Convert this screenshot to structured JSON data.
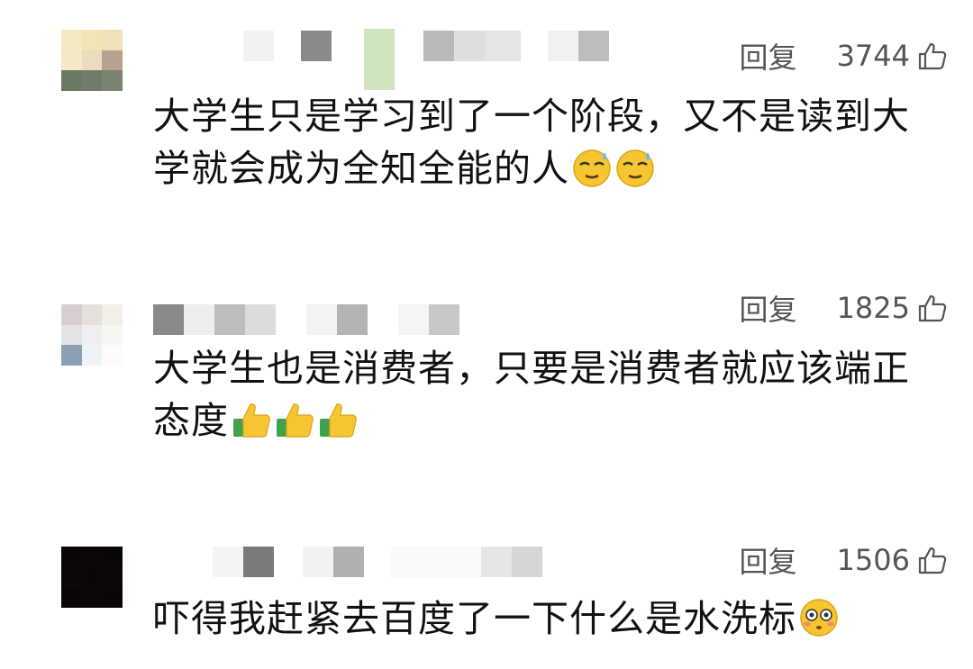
{
  "comments": [
    {
      "reply_label": "回复",
      "likes": "3744",
      "text": "大学生只是学习到了一个阶段，又不是读到大学就会成为全知全能的人",
      "emojis": [
        "sweat-smile-face-icon",
        "sweat-smile-face-icon"
      ]
    },
    {
      "reply_label": "回复",
      "likes": "1825",
      "text": "大学生也是消费者，只要是消费者就应该端正态度",
      "emojis": [
        "thumbs-up-icon",
        "thumbs-up-icon",
        "thumbs-up-icon"
      ]
    },
    {
      "reply_label": "回复",
      "likes": "1506",
      "text": "吓得我赶紧去百度了一下什么是水洗标",
      "emojis": [
        "flushed-face-icon"
      ]
    }
  ],
  "colors": {
    "text": "#111111",
    "meta": "#555555",
    "emoji_yellow": "#f7c531",
    "thumb_green": "#3fa34d"
  }
}
